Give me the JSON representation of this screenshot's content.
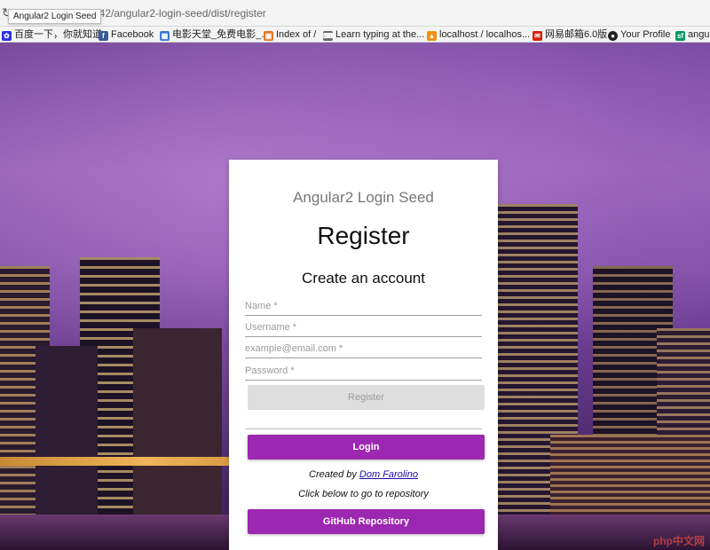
{
  "browser": {
    "url": "342/angular2-login-seed/dist/register",
    "tab_tooltip": "Angular2 Login Seed",
    "bookmarks": [
      {
        "label": "百度一下，你就知道",
        "icon": "paw-icon",
        "color": "#2932e1"
      },
      {
        "label": "Facebook",
        "icon": "facebook-icon",
        "color": "#3b5998"
      },
      {
        "label": "电影天堂_免费电影_...",
        "icon": "grid-icon",
        "color": "#3a7bd5"
      },
      {
        "label": "Index of /",
        "icon": "index-icon",
        "color": "#e0782b"
      },
      {
        "label": "Learn typing at the...",
        "icon": "keyboard-icon",
        "color": "#666666"
      },
      {
        "label": "localhost / localhos...",
        "icon": "phpmyadmin-icon",
        "color": "#f29111"
      },
      {
        "label": "网易邮箱6.0版",
        "icon": "netease-icon",
        "color": "#d81e06"
      },
      {
        "label": "Your Profile",
        "icon": "github-icon",
        "color": "#222222"
      },
      {
        "label": "angul",
        "icon": "sf-icon",
        "color": "#009a61"
      }
    ]
  },
  "card": {
    "app_title": "Angular2 Login Seed",
    "page_title": "Register",
    "subheading": "Create an account",
    "fields": {
      "name_placeholder": "Name *",
      "username_placeholder": "Username *",
      "email_placeholder": "example@email.com *",
      "password_placeholder": "Password *"
    },
    "register_button": "Register",
    "login_button": "Login",
    "credit_prefix": "Created by",
    "credit_author": "Dom Farolino",
    "repo_hint": "Click below to go to repository",
    "github_button": "GitHub Repository"
  },
  "watermark": "php中文网",
  "colors": {
    "accent": "#9c27b0",
    "disabled_button": "#dedede",
    "link": "#1a0dab"
  }
}
